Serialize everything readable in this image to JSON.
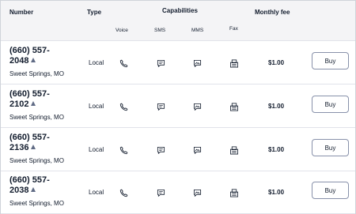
{
  "header": {
    "number": "Number",
    "type": "Type",
    "capabilities": "Capabilities",
    "monthly_fee": "Monthly fee",
    "voice": "Voice",
    "sms": "SMS",
    "mms": "MMS",
    "fax": "Fax"
  },
  "rows": [
    {
      "number_line1": "(660) 557-",
      "number_line2": "2048",
      "location": "Sweet Springs, MO",
      "type": "Local",
      "fee": "$1.00",
      "buy": "Buy"
    },
    {
      "number_line1": "(660) 557-",
      "number_line2": "2102",
      "location": "Sweet Springs, MO",
      "type": "Local",
      "fee": "$1.00",
      "buy": "Buy"
    },
    {
      "number_line1": "(660) 557-",
      "number_line2": "2136",
      "location": "Sweet Springs, MO",
      "type": "Local",
      "fee": "$1.00",
      "buy": "Buy"
    },
    {
      "number_line1": "(660) 557-",
      "number_line2": "2038",
      "location": "Sweet Springs, MO",
      "type": "Local",
      "fee": "$1.00",
      "buy": "Buy"
    }
  ],
  "icons": {
    "voice": "phone-icon",
    "sms": "chat-bubble-icon",
    "mms": "image-message-icon",
    "fax": "fax-icon",
    "warning": "warning-triangle-icon"
  }
}
